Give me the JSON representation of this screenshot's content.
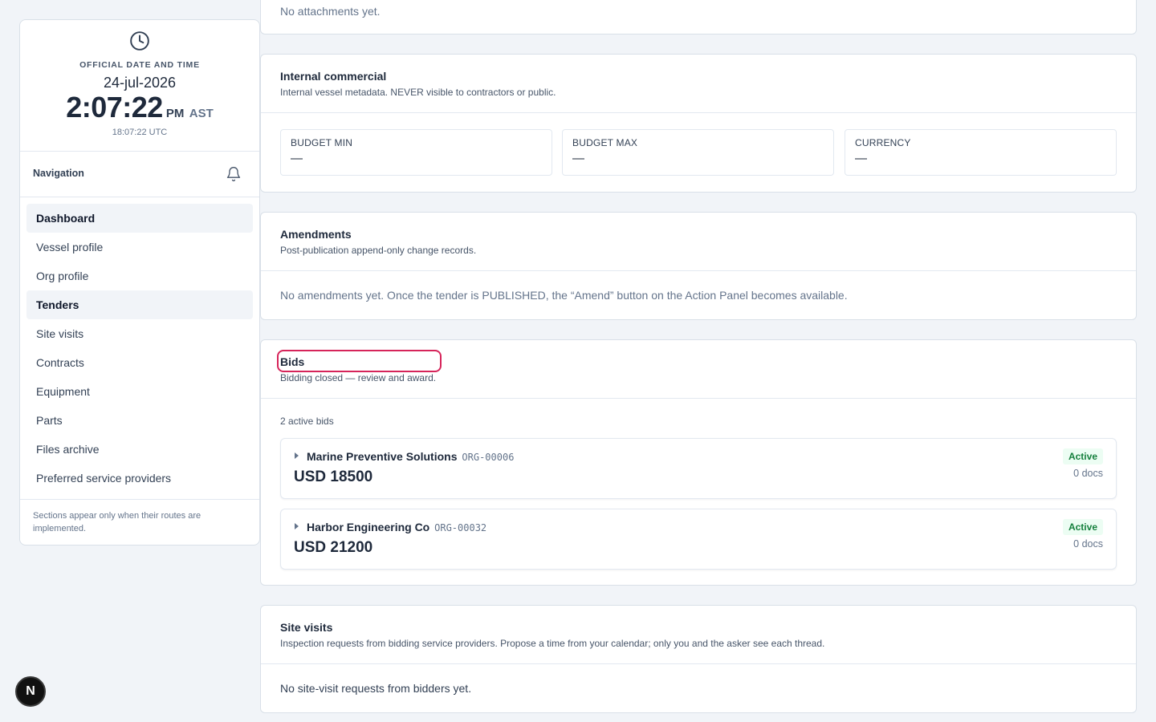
{
  "clock": {
    "label": "OFFICIAL DATE AND TIME",
    "date": "24-jul-2026",
    "time": "2:07:22",
    "ampm": "PM",
    "tz": "AST",
    "utc": "18:07:22 UTC"
  },
  "navigation": {
    "title": "Navigation",
    "items": [
      {
        "label": "Dashboard"
      },
      {
        "label": "Vessel profile"
      },
      {
        "label": "Org profile"
      },
      {
        "label": "Tenders"
      },
      {
        "label": "Site visits"
      },
      {
        "label": "Contracts"
      },
      {
        "label": "Equipment"
      },
      {
        "label": "Parts"
      },
      {
        "label": "Files archive"
      },
      {
        "label": "Preferred service providers"
      }
    ],
    "note": "Sections appear only when their routes are implemented."
  },
  "attachments": {
    "empty_text": "No attachments yet."
  },
  "internal_commercial": {
    "title": "Internal commercial",
    "subtitle": "Internal vessel metadata. NEVER visible to contractors or public.",
    "fields": [
      {
        "label": "BUDGET MIN",
        "value": "—"
      },
      {
        "label": "BUDGET MAX",
        "value": "—"
      },
      {
        "label": "CURRENCY",
        "value": "—"
      }
    ]
  },
  "amendments": {
    "title": "Amendments",
    "subtitle": "Post-publication append-only change records.",
    "empty_text": "No amendments yet. Once the tender is PUBLISHED, the “Amend” button on the Action Panel becomes available."
  },
  "bids": {
    "title": "Bids",
    "subtitle": "Bidding closed — review and award.",
    "count_text": "2 active bids",
    "items": [
      {
        "name": "Marine Preventive Solutions",
        "org": "ORG-00006",
        "amount": "USD 18500",
        "status": "Active",
        "docs": "0 docs"
      },
      {
        "name": "Harbor Engineering Co",
        "org": "ORG-00032",
        "amount": "USD 21200",
        "status": "Active",
        "docs": "0 docs"
      }
    ]
  },
  "site_visits": {
    "title": "Site visits",
    "subtitle": "Inspection requests from bidding service providers. Propose a time from your calendar; only you and the asker see each thread.",
    "empty_text": "No site-visit requests from bidders yet."
  },
  "dev_badge": {
    "label": "N"
  },
  "colors": {
    "background": "#f1f4f8",
    "highlight": "#d6245a",
    "status_active_text": "#15803d",
    "status_active_bg": "#ecfdf3"
  }
}
